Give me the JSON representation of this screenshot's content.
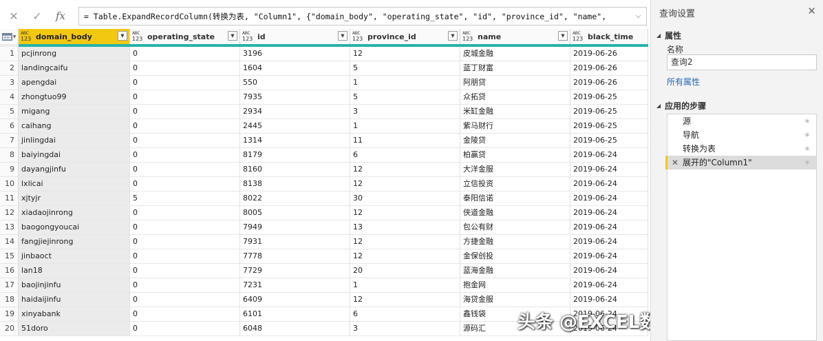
{
  "formula": {
    "cancel_icon": "✕",
    "commit_icon": "✓",
    "fx_label": "fx",
    "text": "= Table.ExpandRecordColumn(转换为表, \"Column1\", {\"domain_body\", \"operating_state\", \"id\", \"province_id\", \"name\","
  },
  "grid": {
    "type_badge_top": "ABC",
    "type_badge_bottom": "123",
    "columns": [
      "domain_body",
      "operating_state",
      "id",
      "province_id",
      "name",
      "black_time"
    ],
    "rows": [
      [
        "1",
        "pcjinrong",
        "0",
        "3196",
        "12",
        "皮城金融",
        "2019-06-26"
      ],
      [
        "2",
        "landingcaifu",
        "0",
        "1604",
        "5",
        "蓝丁财富",
        "2019-06-26"
      ],
      [
        "3",
        "apengdai",
        "0",
        "550",
        "1",
        "阿朋贷",
        "2019-06-26"
      ],
      [
        "4",
        "zhongtuo99",
        "0",
        "7935",
        "5",
        "众拓贷",
        "2019-06-25"
      ],
      [
        "5",
        "migang",
        "0",
        "2934",
        "3",
        "米缸金融",
        "2019-06-25"
      ],
      [
        "6",
        "caihang",
        "0",
        "2445",
        "1",
        "紫马财行",
        "2019-06-25"
      ],
      [
        "7",
        "jinlingdai",
        "0",
        "1314",
        "11",
        "金陵贷",
        "2019-06-25"
      ],
      [
        "8",
        "baiyingdai",
        "0",
        "8179",
        "6",
        "柏赢贷",
        "2019-06-24"
      ],
      [
        "9",
        "dayangjinfu",
        "0",
        "8160",
        "12",
        "大洋金服",
        "2019-06-24"
      ],
      [
        "10",
        "lxlicai",
        "0",
        "8138",
        "12",
        "立信投资",
        "2019-06-24"
      ],
      [
        "11",
        "xjtyjr",
        "5",
        "8022",
        "30",
        "泰阳信诺",
        "2019-06-24"
      ],
      [
        "12",
        "xiadaojinrong",
        "0",
        "8005",
        "12",
        "侠道金融",
        "2019-06-24"
      ],
      [
        "13",
        "baogongyoucai",
        "0",
        "7949",
        "13",
        "包公有财",
        "2019-06-24"
      ],
      [
        "14",
        "fangjiejinrong",
        "0",
        "7931",
        "12",
        "方捷金融",
        "2019-06-24"
      ],
      [
        "15",
        "jinbaoct",
        "0",
        "7778",
        "12",
        "金保创投",
        "2019-06-24"
      ],
      [
        "16",
        "lan18",
        "0",
        "7729",
        "20",
        "蓝海金融",
        "2019-06-24"
      ],
      [
        "17",
        "baojinjinfu",
        "0",
        "7231",
        "1",
        "抱金网",
        "2019-06-24"
      ],
      [
        "18",
        "haidaijinfu",
        "0",
        "6409",
        "12",
        "海贷金服",
        "2019-06-24"
      ],
      [
        "19",
        "xinyabank",
        "0",
        "6101",
        "6",
        "鑫钱袋",
        "2019-06-24"
      ],
      [
        "20",
        "51doro",
        "0",
        "6048",
        "3",
        "源码汇",
        "2019-06-24"
      ]
    ]
  },
  "watermark": "头条 @EXCEL数据处理与分析",
  "pane": {
    "title": "查询设置",
    "close_icon": "✕",
    "properties_header": "属性",
    "name_label": "名称",
    "name_value": "查询2",
    "all_properties_link": "所有属性",
    "steps_header": "应用的步骤",
    "steps": [
      "源",
      "导航",
      "转换为表",
      "展开的\"Column1\""
    ],
    "selected_step_index": 3
  },
  "colors": {
    "active_column_header": "#f2c811",
    "quality_bar": "#24b3a9",
    "link": "#1f67b8"
  }
}
